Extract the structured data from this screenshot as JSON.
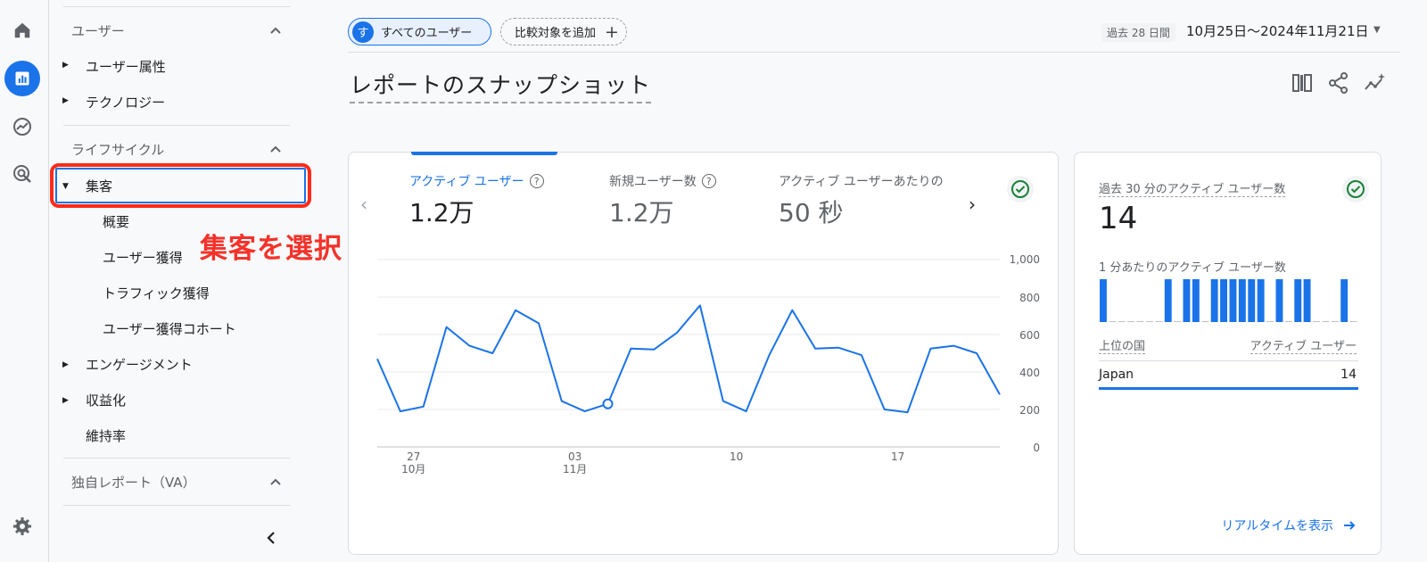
{
  "rail": {
    "items": [
      {
        "icon": "home-icon"
      },
      {
        "icon": "reports-icon",
        "active": true
      },
      {
        "icon": "explore-icon"
      },
      {
        "icon": "advertising-icon"
      },
      {
        "icon": "settings-icon"
      }
    ]
  },
  "nav": {
    "section_user": "ユーザー",
    "user_items": [
      "ユーザー属性",
      "テクノロジー"
    ],
    "section_lifecycle": "ライフサイクル",
    "acquisition": "集客",
    "acquisition_sub": [
      "概要",
      "ユーザー獲得",
      "トラフィック獲得",
      "ユーザー獲得コホート"
    ],
    "engagement": "エンゲージメント",
    "monetization": "収益化",
    "retention": "維持率",
    "section_custom": "独自レポート（VA）"
  },
  "annotation": "集客を選択",
  "topbar": {
    "user_chip_avatar": "す",
    "user_chip": "すべてのユーザー",
    "compare_chip": "比較対象を追加",
    "date_label": "過去 28 日間",
    "date_range": "10月25日～2024年11月21日"
  },
  "page_title": "レポートのスナップショット",
  "metrics": [
    {
      "label": "アクティブ ユーザー",
      "value": "1.2万"
    },
    {
      "label": "新規ユーザー数",
      "value": "1.2万"
    },
    {
      "label": "アクティブ ユーザーあたりの",
      "value": "50 秒"
    }
  ],
  "chart_data": {
    "type": "line",
    "series": [
      {
        "values": [
          470,
          190,
          215,
          640,
          540,
          500,
          730,
          660,
          245,
          190,
          230,
          525,
          520,
          610,
          755,
          245,
          190,
          490,
          730,
          525,
          530,
          490,
          200,
          185,
          525,
          540,
          500,
          280
        ]
      }
    ],
    "ylim": [
      0,
      1000
    ],
    "yticks": [
      "1,000",
      "800",
      "600",
      "400",
      "200",
      "0"
    ],
    "xticks": [
      {
        "line1": "27",
        "line2": "10月"
      },
      {
        "line1": "03",
        "line2": "11月"
      },
      {
        "line1": "10",
        "line2": ""
      },
      {
        "line1": "17",
        "line2": ""
      }
    ],
    "grid": true
  },
  "realtime": {
    "label": "過去 30 分のアクティブ ユーザー数",
    "value": "14",
    "sub_label": "1 分あたりのアクティブ ユーザー数",
    "bars": [
      1,
      0,
      0,
      0,
      0,
      0,
      0,
      1,
      0,
      1,
      1,
      0,
      1,
      1,
      1,
      1,
      1,
      1,
      0,
      1,
      0,
      1,
      1,
      0,
      0,
      0,
      1,
      0
    ],
    "col_country": "上位の国",
    "col_users": "アクティブ ユーザー",
    "country": "Japan",
    "count": "14",
    "link": "リアルタイムを表示"
  },
  "colors": {
    "accent": "#1a73e8",
    "annotation": "#f5322a"
  }
}
